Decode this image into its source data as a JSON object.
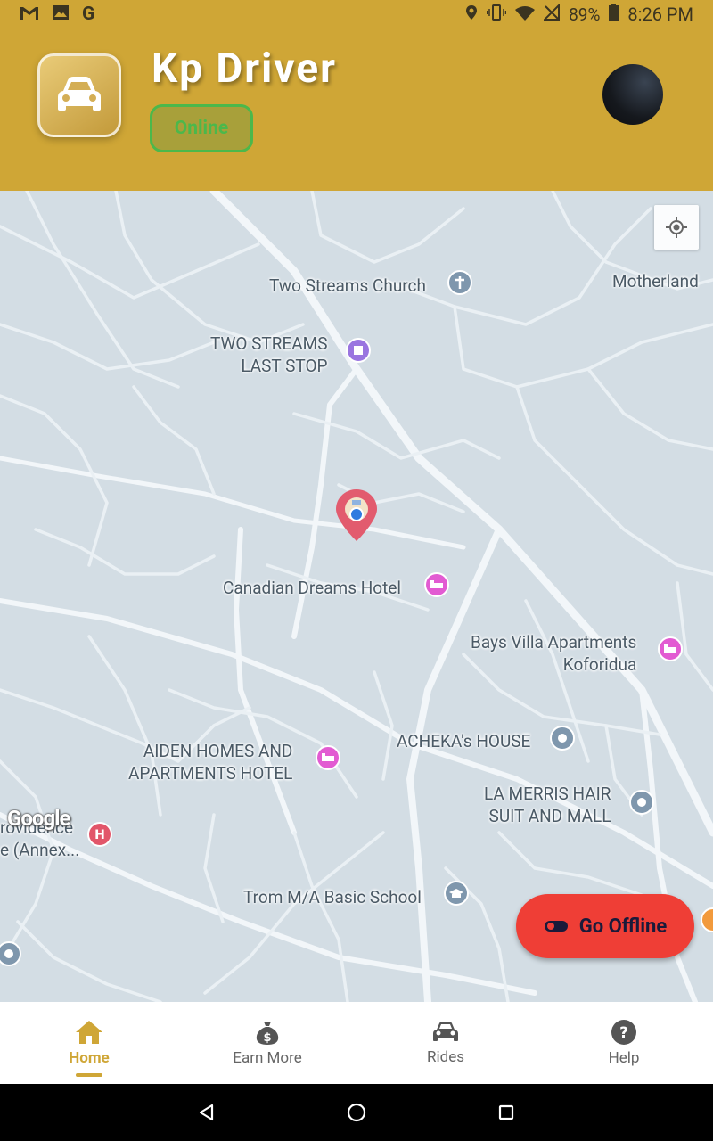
{
  "status_bar": {
    "battery": "89%",
    "time": "8:26 PM"
  },
  "header": {
    "title": "Kp Driver",
    "status": "Online"
  },
  "map": {
    "attribution": "Google",
    "places": [
      {
        "key": "church",
        "label": "Two Streams Church"
      },
      {
        "key": "motherland",
        "label": "Motherland"
      },
      {
        "key": "laststop",
        "label": "TWO STREAMS\nLAST STOP"
      },
      {
        "key": "canadian",
        "label": "Canadian Dreams Hotel"
      },
      {
        "key": "baysvilla",
        "label": "Bays Villa Apartments\nKoforidua"
      },
      {
        "key": "aiden",
        "label": "AIDEN HOMES AND\nAPARTMENTS HOTEL"
      },
      {
        "key": "acheka",
        "label": "ACHEKA's HOUSE"
      },
      {
        "key": "lamerris",
        "label": "LA MERRIS HAIR\nSUIT AND MALL"
      },
      {
        "key": "providence",
        "label": "rovidence\ne (Annex..."
      },
      {
        "key": "trom",
        "label": "Trom M/A Basic School"
      }
    ]
  },
  "actions": {
    "go_offline": "Go Offline"
  },
  "bottom_nav": {
    "items": [
      {
        "label": "Home",
        "icon": "home-icon",
        "active": true
      },
      {
        "label": "Earn More",
        "icon": "money-bag-icon",
        "active": false
      },
      {
        "label": "Rides",
        "icon": "car-icon",
        "active": false
      },
      {
        "label": "Help",
        "icon": "help-icon",
        "active": false
      }
    ]
  },
  "colors": {
    "brand": "#cfa636",
    "online_green": "#4cb84b",
    "offline_red": "#ef3e36"
  }
}
